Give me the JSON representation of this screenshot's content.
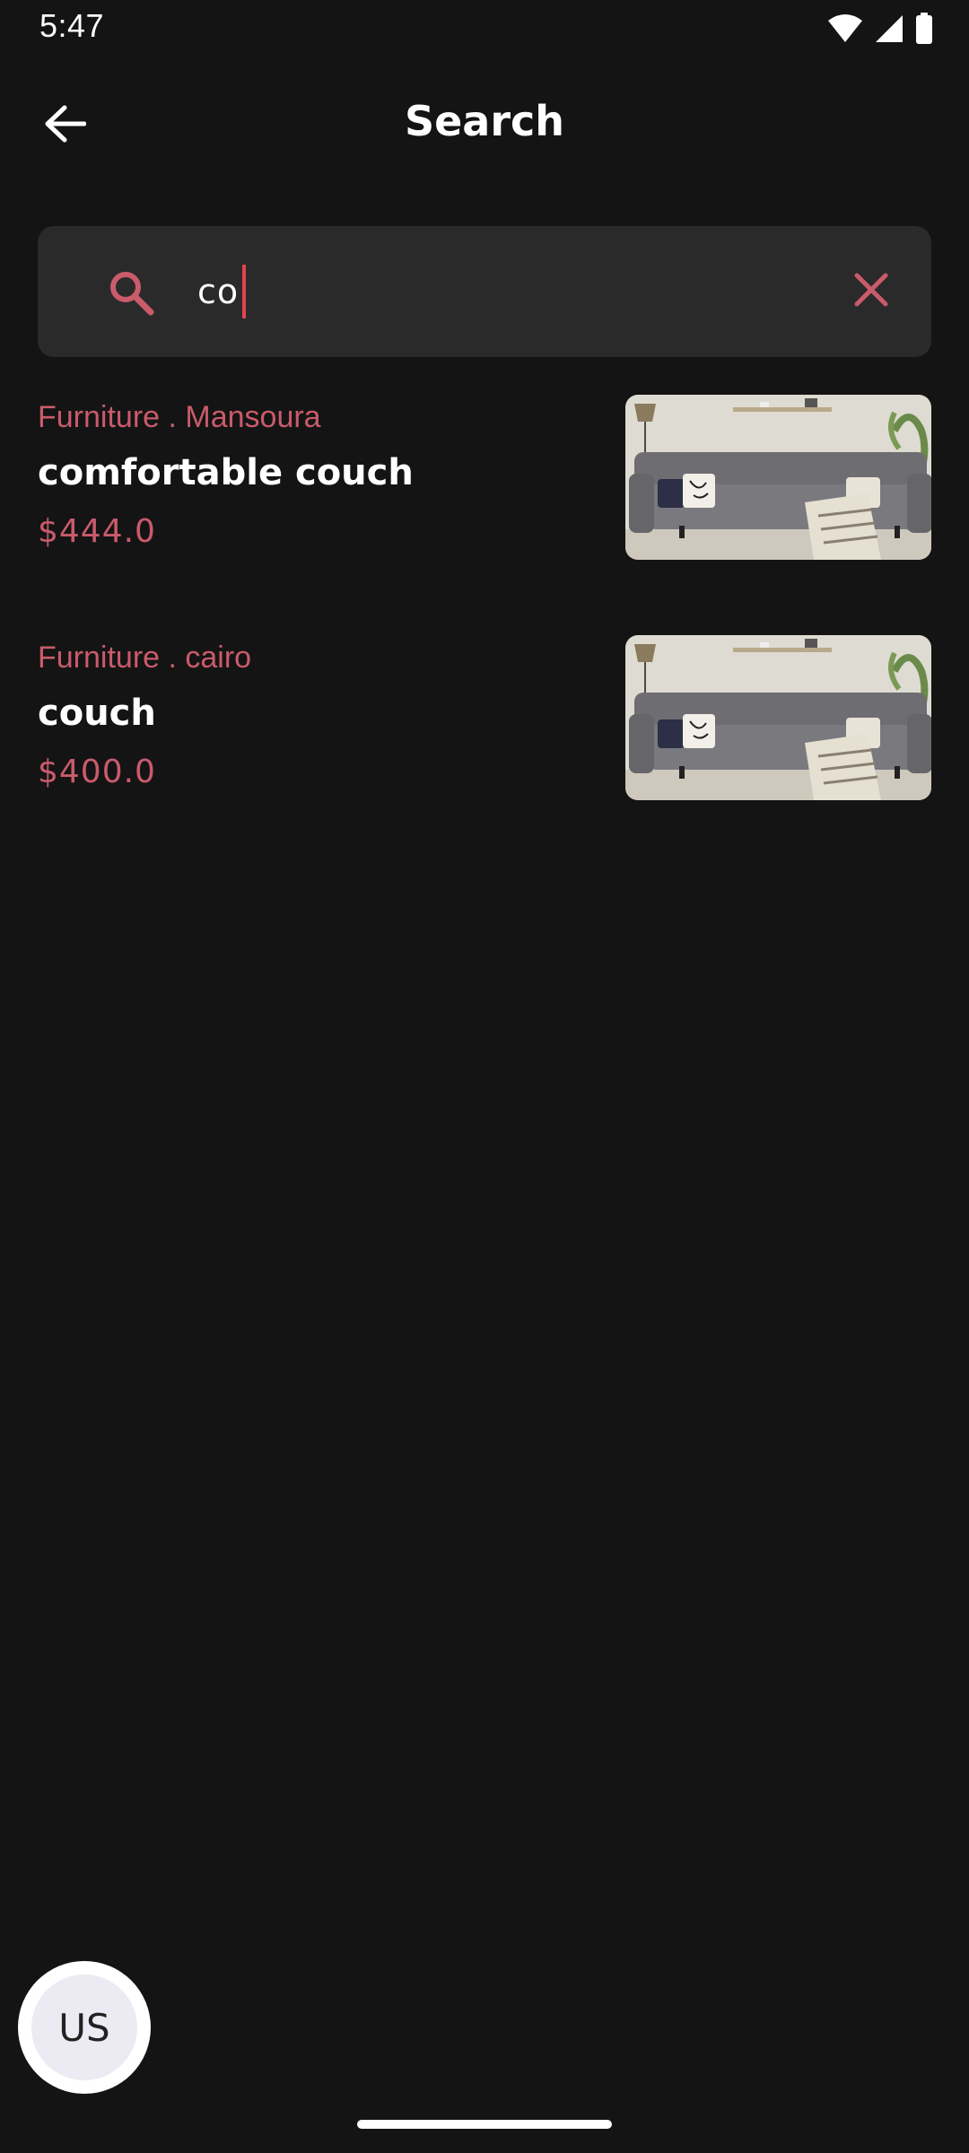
{
  "status_bar": {
    "time": "5:47",
    "icons": [
      "wifi-icon",
      "cellular-signal-icon",
      "battery-icon"
    ]
  },
  "app_bar": {
    "back_icon": "arrow-left-icon",
    "title": "Search"
  },
  "search": {
    "value": "co",
    "search_icon": "magnifier-icon",
    "clear_icon": "close-icon"
  },
  "results": [
    {
      "meta": "Furniture . Mansoura",
      "title": "comfortable couch",
      "price": "$444.0",
      "image": "grey-sofa-photo"
    },
    {
      "meta": "Furniture . cairo",
      "title": "couch",
      "price": "$400.0",
      "image": "grey-sofa-photo"
    }
  ],
  "avatar": {
    "label": "US"
  },
  "colors": {
    "background": "#141414",
    "surface": "#2a2a2a",
    "accent": "#c95b6b",
    "caret": "#e0434f",
    "text": "#ffffff"
  }
}
